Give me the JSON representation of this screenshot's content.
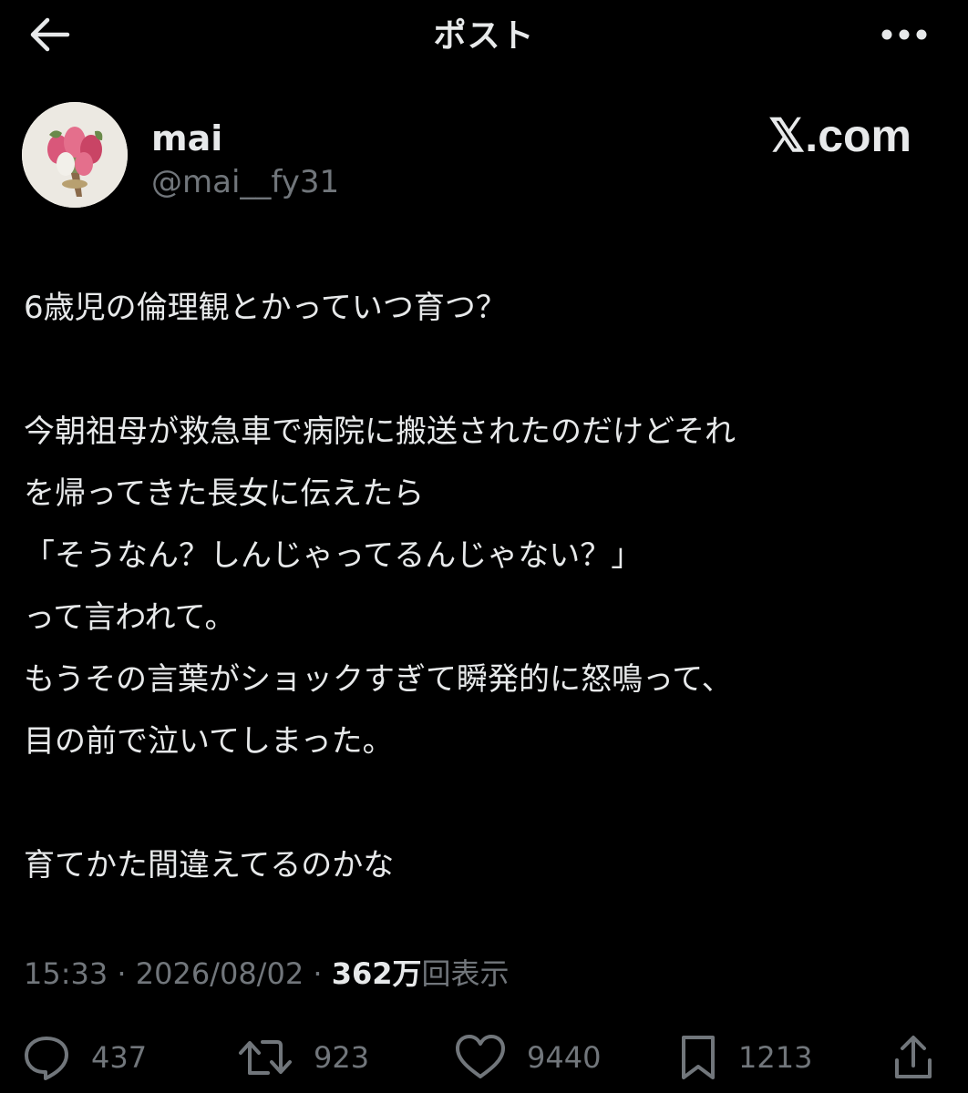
{
  "header": {
    "title": "ポスト",
    "back_icon": "arrow-left-icon",
    "more_icon": "more-horizontal-icon"
  },
  "author": {
    "display_name": "mai",
    "handle": "@mai__fy31",
    "avatar_icon": "flower-bouquet-avatar"
  },
  "watermark": "𝕏.com",
  "post": {
    "lines": [
      "6歳児の倫理観とかっていつ育つ？",
      "",
      "今朝祖母が救急車で病院に搬送されたのだけどそれ",
      "を帰ってきた長女に伝えたら",
      "「そうなん？しんじゃってるんじゃない？」",
      "って言われて。",
      "もうその言葉がショックすぎて瞬発的に怒鳴って、",
      "目の前で泣いてしまった。",
      "",
      "育てかた間違えてるのかな"
    ]
  },
  "meta": {
    "time": "15:33",
    "separator": " · ",
    "date": "2026/08/02",
    "views_count": "362万",
    "views_label": "回表示"
  },
  "actions": {
    "reply": {
      "icon": "reply-icon",
      "count": "437"
    },
    "repost": {
      "icon": "repost-icon",
      "count": "923"
    },
    "like": {
      "icon": "heart-icon",
      "count": "9440"
    },
    "bookmark": {
      "icon": "bookmark-icon",
      "count": "1213"
    },
    "share": {
      "icon": "share-icon"
    }
  },
  "colors": {
    "background": "#000000",
    "primary_text": "#e7e9ea",
    "secondary_text": "#71767b"
  }
}
